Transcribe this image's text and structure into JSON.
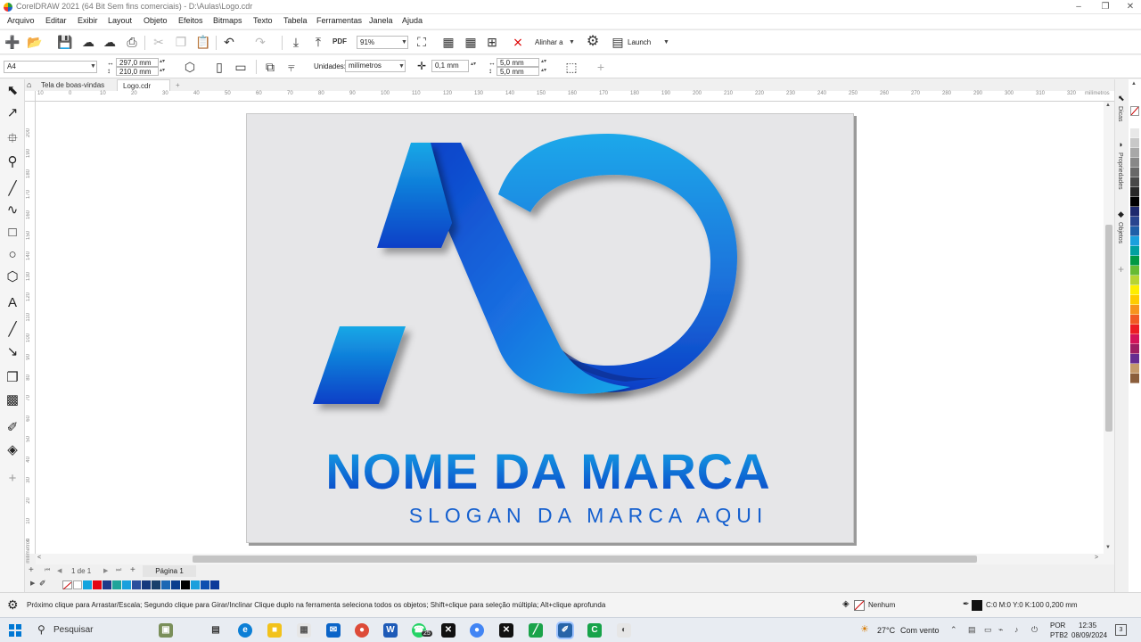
{
  "window": {
    "title": "CorelDRAW 2021 (64 Bit Sem fins comerciais) - D:\\Aulas\\Logo.cdr",
    "controls": [
      "–",
      "❐",
      "✕"
    ]
  },
  "menu": [
    "Arquivo",
    "Editar",
    "Exibir",
    "Layout",
    "Objeto",
    "Efeitos",
    "Bitmaps",
    "Texto",
    "Tabela",
    "Ferramentas",
    "Janela",
    "Ajuda"
  ],
  "toolbar": {
    "zoom": "91%",
    "align_label": "Alinhar a",
    "launch_label": "Launch",
    "pdf_label": "PDF"
  },
  "propertybar": {
    "page_size": "A4",
    "width": "297,0 mm",
    "height": "210,0 mm",
    "units_label": "Unidades:",
    "units_value": "milímetros",
    "nudge": "0,1 mm",
    "dup_x": "5,0 mm",
    "dup_y": "5,0 mm"
  },
  "tabs": {
    "welcome": "Tela de boas-vindas",
    "document": "Logo.cdr",
    "add": "+"
  },
  "rulers": {
    "top_ticks": [
      "10",
      "0",
      "10",
      "20",
      "30",
      "40",
      "50",
      "60",
      "70",
      "80",
      "90",
      "100",
      "110",
      "120",
      "130",
      "140",
      "150",
      "160",
      "170",
      "180",
      "190",
      "200",
      "210",
      "220",
      "230",
      "240",
      "250",
      "260",
      "270",
      "280",
      "290",
      "300",
      "310",
      "320"
    ],
    "top_unit": "milímetros",
    "left_ticks": [
      "200",
      "190",
      "180",
      "170",
      "160",
      "150",
      "140",
      "130",
      "120",
      "110",
      "100",
      "90",
      "80",
      "70",
      "60",
      "50",
      "40",
      "30",
      "20",
      "10",
      "0"
    ],
    "left_unit": "milímetros"
  },
  "logo": {
    "brand_name": "NOME DA MARCA",
    "slogan": "SLOGAN DA MARCA AQUI"
  },
  "dockers": {
    "dicas": "Dicas",
    "propriedades": "Propriedades",
    "objetos": "Objetos"
  },
  "pagenav": {
    "page_of": "1 de 1",
    "page_tab": "Página 1"
  },
  "status": {
    "hint": "Próximo clique para Arrastar/Escala; Segundo clique para Girar/Inclinar Clique duplo na ferramenta seleciona todos os objetos; Shift+clique para seleção múltipla; Alt+clique aprofunda",
    "fill": "Nenhum",
    "outline": "C:0 M:0 Y:0 K:100  0,200 mm"
  },
  "taskbar": {
    "search": "Pesquisar",
    "weather_temp": "27°C",
    "weather_text": "Com vento",
    "lang1": "POR",
    "lang2": "PTB2",
    "time": "12:35",
    "date": "08/09/2024",
    "notif_count": "3",
    "whatsapp_badge": "25"
  },
  "palette_colors": [
    "#ffffff",
    "#e8e8e8",
    "#c8c8c8",
    "#a8a8a8",
    "#888888",
    "#686868",
    "#484848",
    "#282828",
    "#000000",
    "#1e2a6e",
    "#29458f",
    "#1f5fa8",
    "#1aa0dd",
    "#00a0a0",
    "#009944",
    "#66bb33",
    "#b8d432",
    "#ffee00",
    "#ffcc00",
    "#f7941d",
    "#f15a24",
    "#ed1c24",
    "#d4145a",
    "#9e1f63",
    "#662d91",
    "#c49a6c",
    "#8b5e3c"
  ],
  "doc_palette_colors": [
    "#ffffff",
    "#13a4de",
    "#e30613",
    "#1e3a8a",
    "#1fa49a",
    "#1aa0dd",
    "#2b4f9e",
    "#163a7e",
    "#19406b",
    "#1b68b4",
    "#0b3f8e",
    "#000000",
    "#1aa0dd",
    "#0f4fb0",
    "#0d3a9a"
  ],
  "colors": {
    "accent": "#1a4fd1",
    "light_blue": "#15a8e6"
  }
}
